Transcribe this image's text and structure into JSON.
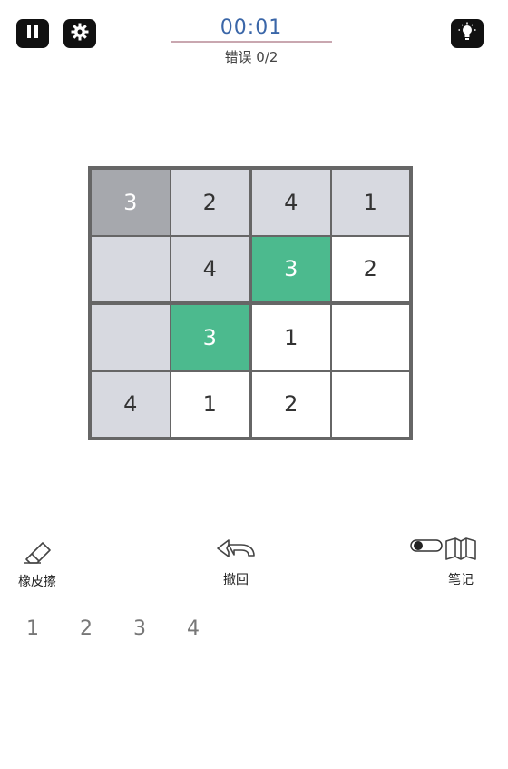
{
  "header": {
    "timer": "00:01",
    "mistakes": "错误 0/2"
  },
  "icons": {
    "pause": "pause-icon",
    "settings": "gear-icon",
    "hint": "lightbulb-icon",
    "eraser": "eraser-icon",
    "undo": "undo-icon",
    "notes": "notebook-icon",
    "toggle": "toggle-icon"
  },
  "board": {
    "rows": [
      [
        "3",
        "2",
        "4",
        "1"
      ],
      [
        "",
        "4",
        "3",
        "2"
      ],
      [
        "",
        "3",
        "1",
        ""
      ],
      [
        "4",
        "1",
        "2",
        ""
      ]
    ],
    "states": [
      [
        "selected",
        "given",
        "given",
        "given"
      ],
      [
        "given",
        "given",
        "highlight",
        "empty"
      ],
      [
        "given",
        "highlight",
        "empty",
        "empty"
      ],
      [
        "given",
        "empty",
        "empty",
        "empty"
      ]
    ]
  },
  "tools": {
    "eraser_label": "橡皮擦",
    "undo_label": "撤回",
    "notes_label": "笔记"
  },
  "numpad": [
    "1",
    "2",
    "3",
    "4"
  ],
  "colors": {
    "highlight": "#4cba8e",
    "given": "#d7d9e0",
    "selected": "#a6a8ad",
    "timer": "#3a66a8"
  }
}
